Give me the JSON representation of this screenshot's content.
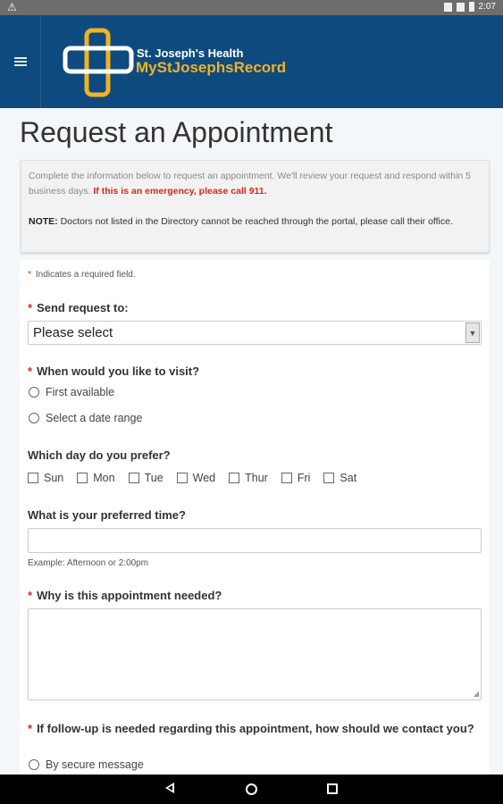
{
  "status_bar": {
    "warning_icon": "warning-icon",
    "time": "2:07",
    "icons": [
      "sim-icon",
      "signal-icon",
      "battery-icon"
    ]
  },
  "header": {
    "brand_line1": "St. Joseph's Health",
    "brand_line2": "MyStJosephsRecord",
    "menu_icon": "hamburger-menu-icon"
  },
  "page": {
    "title": "Request an Appointment",
    "intro": "Complete the information below to request an appointment. We'll review your request and respond within 5 business days.",
    "emergency": "If this is an emergency, please call 911.",
    "note_label": "NOTE:",
    "note_text": "Doctors not listed in the Directory cannot be reached through the portal, please call their office."
  },
  "form": {
    "required_note": "Indicates a required field.",
    "required_star": "*",
    "send_to_label": "Send request to:",
    "send_to_value": "Please select",
    "visit_label": "When would you like to visit?",
    "visit_options": [
      "First available",
      "Select a date range"
    ],
    "day_label": "Which day do you prefer?",
    "days": [
      "Sun",
      "Mon",
      "Tue",
      "Wed",
      "Thur",
      "Fri",
      "Sat"
    ],
    "time_label": "What is your preferred time?",
    "time_value": "",
    "time_hint": "Example: Afternoon or 2:00pm",
    "reason_label": "Why is this appointment needed?",
    "reason_value": "",
    "followup_label": "If follow-up is needed regarding this appointment, how should we contact you?",
    "followup_options": [
      "By secure message"
    ]
  },
  "colors": {
    "header_bg": "#0e4a7e",
    "brand_gold": "#f0b323",
    "required_red": "#e2261c"
  }
}
